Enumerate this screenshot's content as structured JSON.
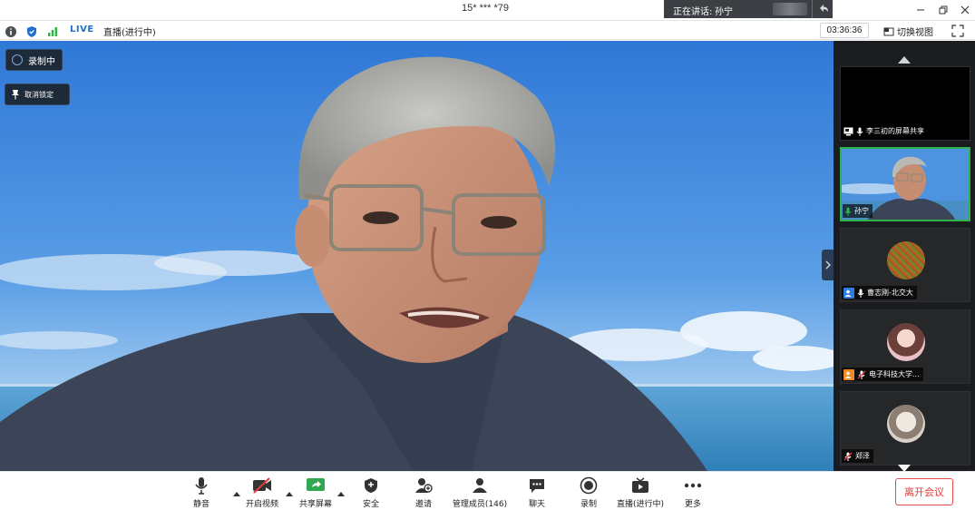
{
  "window": {
    "title": "15* *** *79"
  },
  "speaking": {
    "label": "正在讲话:",
    "name": "孙宁"
  },
  "infobar": {
    "live_badge": "LIVE",
    "live_status": "直播(进行中)",
    "timer": "03:36:36",
    "switch_view": "切换视图"
  },
  "overlay": {
    "recording": "录制中",
    "unpin": "取消锁定"
  },
  "participants": [
    {
      "name": "李三初的屏幕共享",
      "kind": "screen-share"
    },
    {
      "name": "孙宁",
      "kind": "video",
      "active": true
    },
    {
      "name": "曹志刚-北交大",
      "kind": "avatar"
    },
    {
      "name": "电子科技大学...",
      "kind": "avatar"
    },
    {
      "name": "郑泽",
      "kind": "avatar"
    }
  ],
  "toolbar": {
    "mute": "静音",
    "start_video": "开启视频",
    "share_screen": "共享屏幕",
    "security": "安全",
    "invite": "邀请",
    "manage_members": "管理成员(146)",
    "chat": "聊天",
    "record": "录制",
    "live": "直播(进行中)",
    "more": "更多",
    "leave": "离开会议"
  },
  "colors": {
    "accent_blue": "#1f6fd1",
    "active_green": "#2fb24a",
    "leave_red": "#e23b3b",
    "panel_dark": "#1b1c1f"
  }
}
